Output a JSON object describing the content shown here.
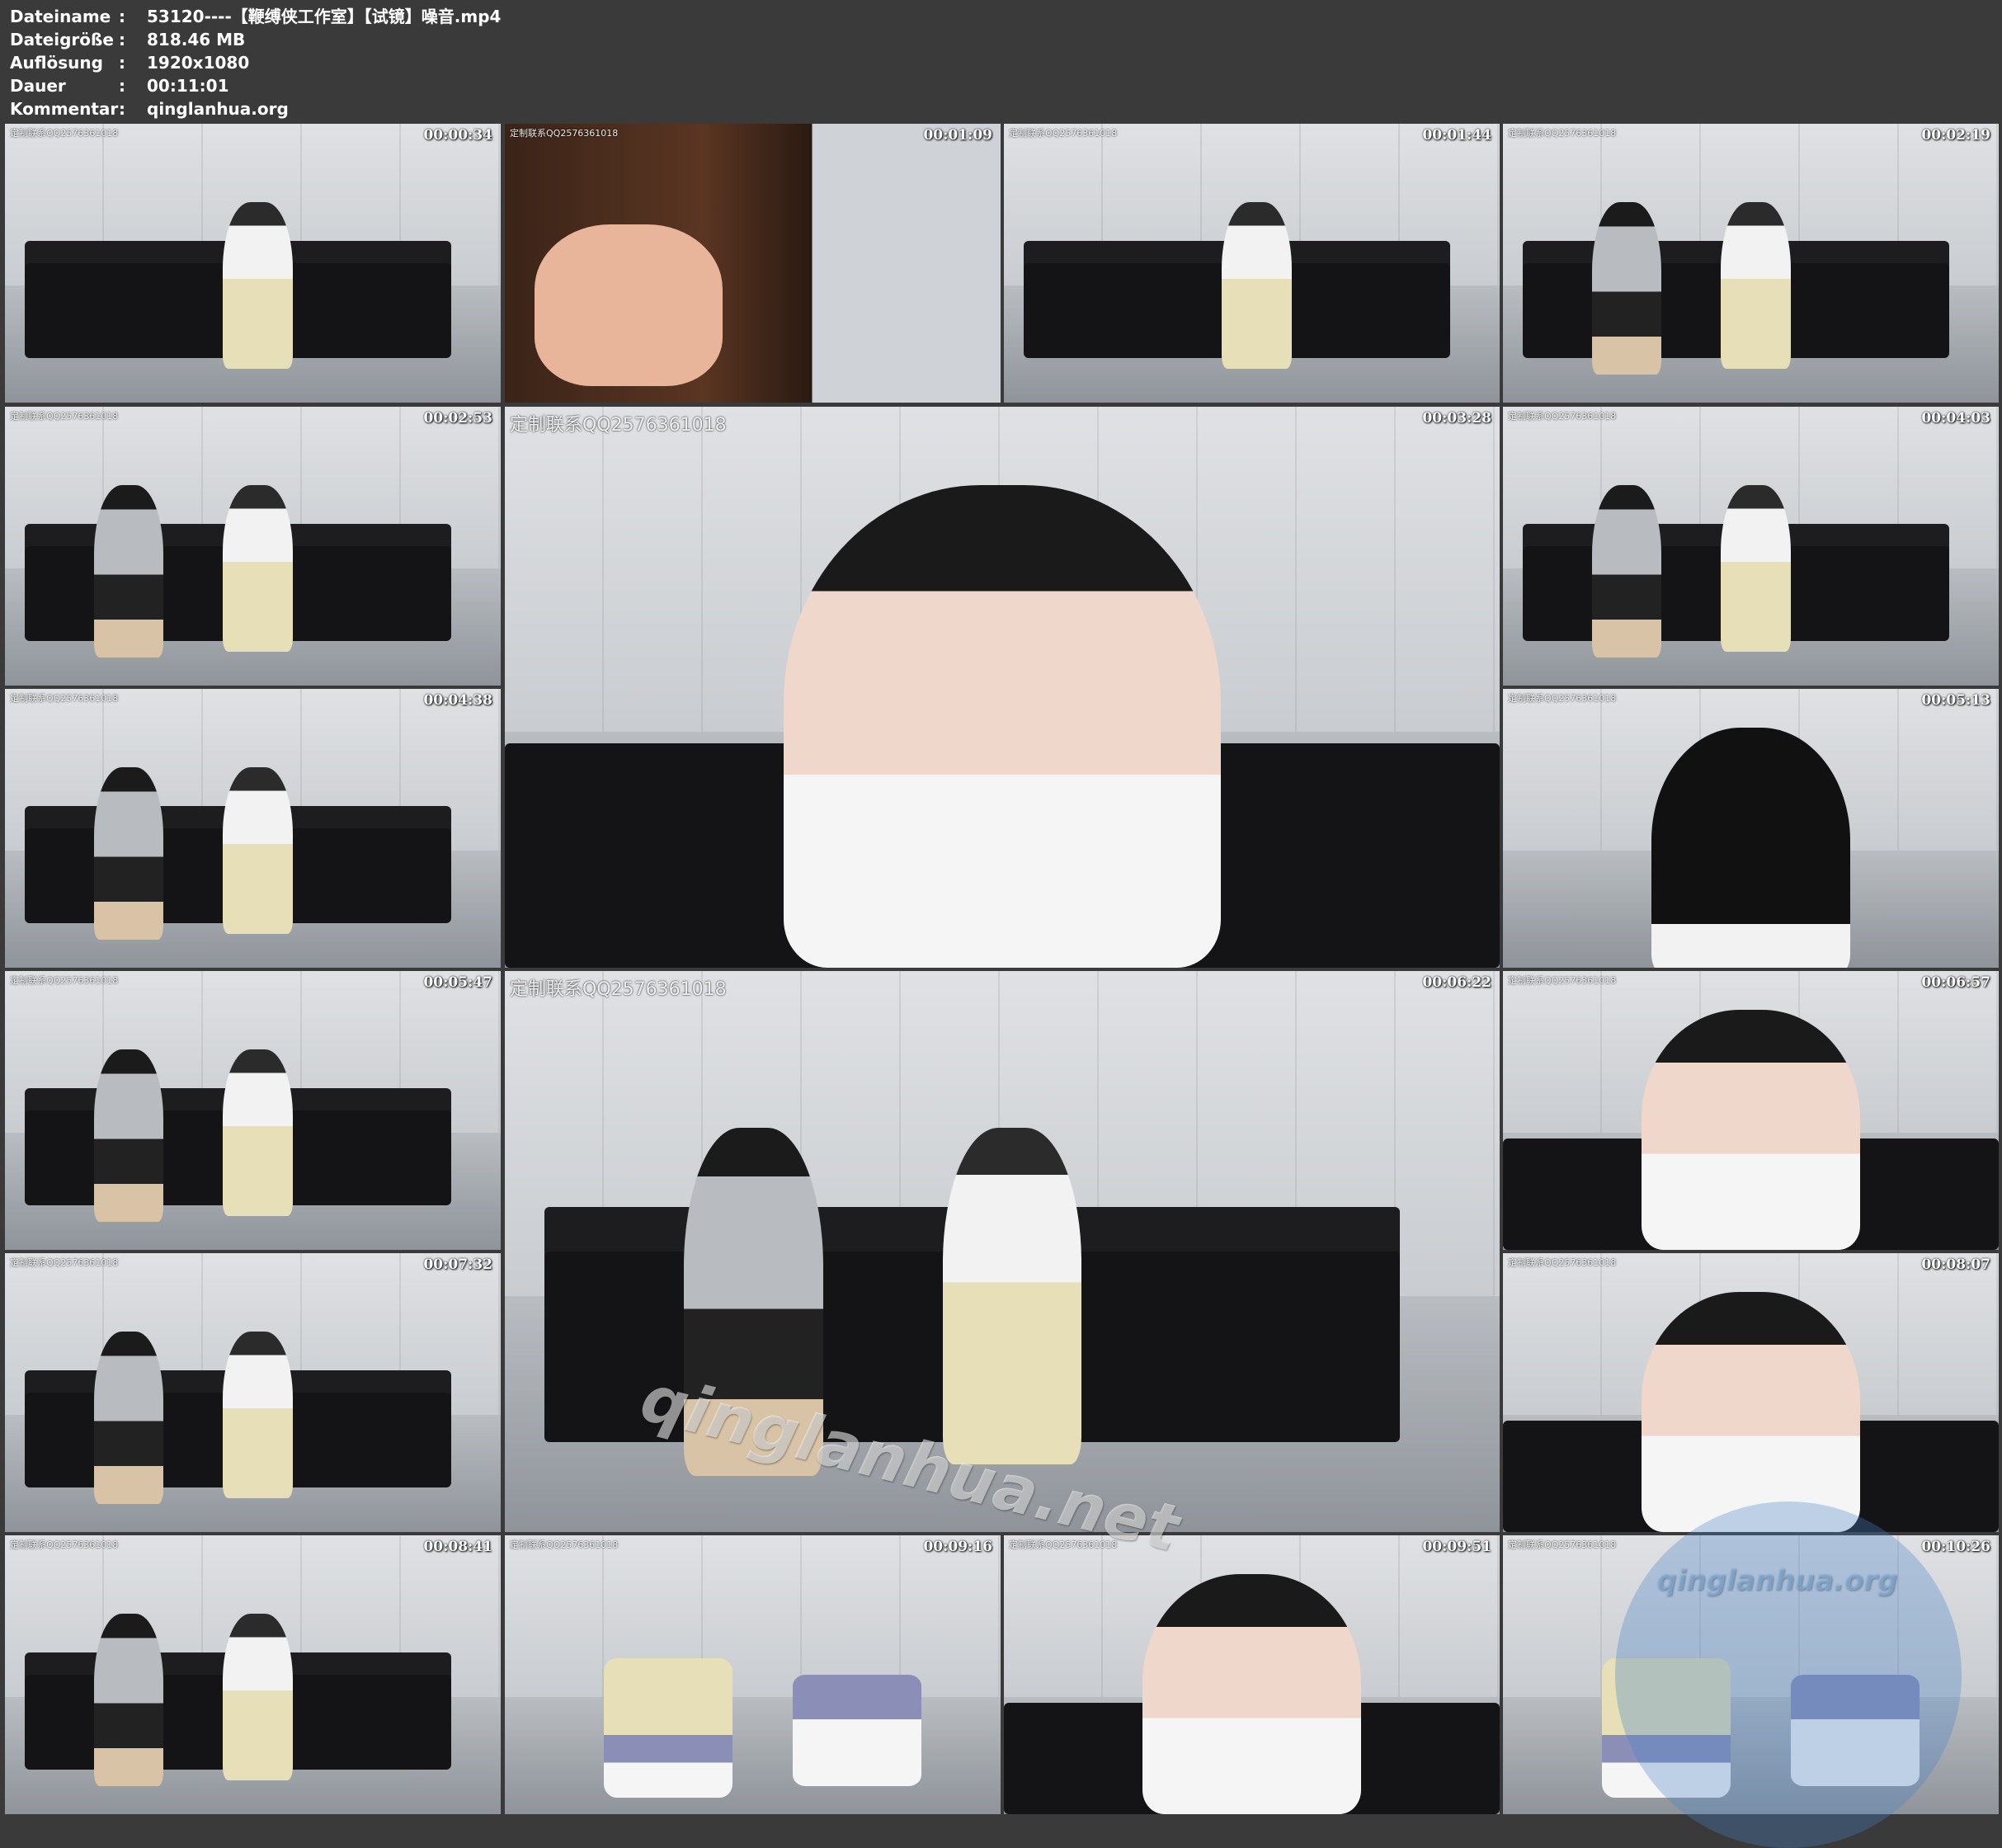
{
  "info": [
    {
      "label": "Dateiname",
      "value": "53120----【鞭缚侠工作室】【试镜】噪音.mp4"
    },
    {
      "label": "Dateigröße",
      "value": "818.46 MB"
    },
    {
      "label": "Auflösung",
      "value": "1920x1080"
    },
    {
      "label": "Dauer",
      "value": "00:11:01"
    },
    {
      "label": "Kommentar",
      "value": "qinglanhua.org"
    }
  ],
  "colon": ":",
  "thumbs": [
    {
      "time": "00:00:34",
      "watermark": "定制联系QQ2576361018",
      "scene": "sofa-girl"
    },
    {
      "time": "00:01:09",
      "watermark": "定制联系QQ2576361018",
      "scene": "hand-door"
    },
    {
      "time": "00:01:44",
      "watermark": "定制联系QQ2576361018",
      "scene": "sofa-girl"
    },
    {
      "time": "00:02:19",
      "watermark": "定制联系QQ2576361018",
      "scene": "sofa-two"
    },
    {
      "time": "00:02:53",
      "watermark": "定制联系QQ2576361018",
      "scene": "sofa-two"
    },
    {
      "time": "00:03:28",
      "watermark": "定制联系QQ2576361018",
      "scene": "closeup-girl"
    },
    {
      "time": "00:04:03",
      "watermark": "定制联系QQ2576361018",
      "scene": "sofa-man"
    },
    {
      "time": "00:04:38",
      "watermark": "定制联系QQ2576361018",
      "scene": "sofa-two"
    },
    {
      "time": "00:05:13",
      "watermark": "定制联系QQ2576361018",
      "scene": "hair-closeup"
    },
    {
      "time": "00:05:47",
      "watermark": "定制联系QQ2576361018",
      "scene": "sofa-two"
    },
    {
      "time": "00:06:22",
      "watermark": "定制联系QQ2576361018",
      "scene": "sofa-lying"
    },
    {
      "time": "00:06:57",
      "watermark": "定制联系QQ2576361018",
      "scene": "closeup-pointing"
    },
    {
      "time": "00:07:32",
      "watermark": "定制联系QQ2576361018",
      "scene": "sofa-two"
    },
    {
      "time": "00:08:07",
      "watermark": "定制联系QQ2576361018",
      "scene": "closeup-face"
    },
    {
      "time": "00:08:41",
      "watermark": "定制联系QQ2576361018",
      "scene": "sofa-two"
    },
    {
      "time": "00:09:16",
      "watermark": "定制联系QQ2576361018",
      "scene": "floor-feet"
    },
    {
      "time": "00:09:51",
      "watermark": "定制联系QQ2576361018",
      "scene": "closeup-face"
    },
    {
      "time": "00:10:26",
      "watermark": "定制联系QQ2576361018",
      "scene": "floor-feet"
    }
  ],
  "overlay_watermarks": {
    "large": "qinglanhua.net",
    "circle": "qinglanhua.org"
  }
}
